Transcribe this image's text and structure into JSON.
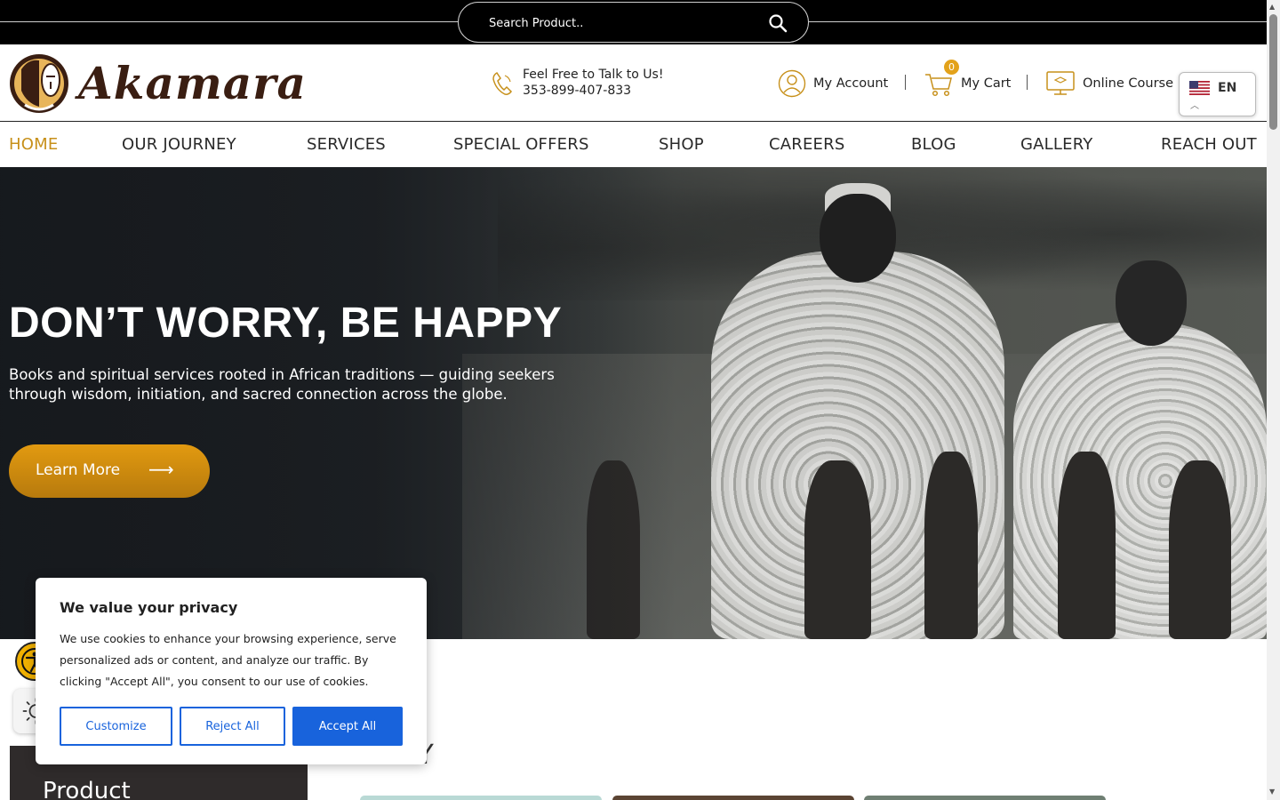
{
  "search": {
    "placeholder": "Search Product.."
  },
  "header": {
    "logo_text": "Akamara",
    "contact_title": "Feel Free to Talk to Us!",
    "contact_phone": "353-899-407-833",
    "account_label": "My Account",
    "cart_label": "My Cart",
    "cart_count": "0",
    "course_label": "Online Course",
    "language": "EN"
  },
  "nav": {
    "items": [
      {
        "label": "HOME",
        "active": true
      },
      {
        "label": "OUR JOURNEY"
      },
      {
        "label": "SERVICES"
      },
      {
        "label": "SPECIAL OFFERS"
      },
      {
        "label": "SHOP"
      },
      {
        "label": "CAREERS"
      },
      {
        "label": "BLOG"
      },
      {
        "label": "GALLERY"
      },
      {
        "label": "REACH OUT"
      }
    ]
  },
  "hero": {
    "title": "DON’T WORRY, BE HAPPY",
    "text": "Books and spiritual services rooted in African traditions — guiding seekers through wisdom, initiation, and sacred connection across the globe.",
    "button_label": "Learn More",
    "button_arrow": "⟶"
  },
  "below": {
    "product_panel": "Product",
    "section_title_partial": "ARY"
  },
  "cookie": {
    "title": "We value your privacy",
    "text": "We use cookies to enhance your browsing experience, serve personalized ads or content, and analyze our traffic. By clicking \"Accept All\", you consent to our use of cookies.",
    "customize": "Customize",
    "reject": "Reject All",
    "accept": "Accept All"
  },
  "colors": {
    "accent": "#c7901a",
    "button_gold": "#e29a10",
    "cookie_blue": "#1863dc"
  },
  "icons": {
    "search": "search-icon",
    "phone": "phone-icon",
    "account": "user-icon",
    "cart": "cart-icon",
    "course": "monitor-icon",
    "flag": "us-flag-icon",
    "accessibility": "accessibility-icon",
    "contrast": "contrast-icon"
  }
}
